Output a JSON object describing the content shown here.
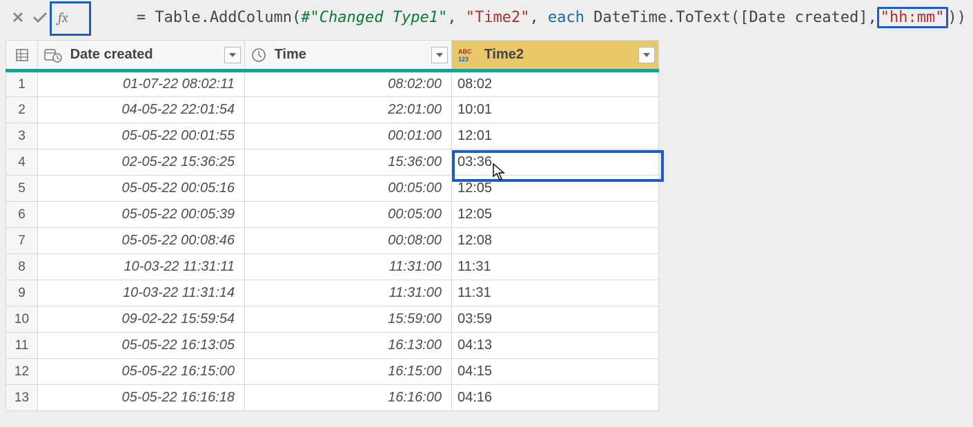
{
  "formula_bar": {
    "eq": "= ",
    "fn1": "Table.AddColumn",
    "open": "(",
    "ref": "#\"Changed Type1\"",
    "c1": ", ",
    "str1": "\"Time2\"",
    "c2": ", ",
    "kw": "each",
    "sp": " ",
    "fn2": "DateTime.ToText",
    "open2": "(",
    "col": "[Date created]",
    "c3": ",",
    "str2": "\"hh:mm\"",
    "close2": ")",
    "close": ")"
  },
  "fx_label": "fx",
  "columns": {
    "date": "Date created",
    "time": "Time",
    "time2": "Time2"
  },
  "rows": [
    {
      "n": "1",
      "date": "01-07-22 08:02:11",
      "time": "08:02:00",
      "time2": "08:02"
    },
    {
      "n": "2",
      "date": "04-05-22 22:01:54",
      "time": "22:01:00",
      "time2": "10:01"
    },
    {
      "n": "3",
      "date": "05-05-22 00:01:55",
      "time": "00:01:00",
      "time2": "12:01"
    },
    {
      "n": "4",
      "date": "02-05-22 15:36:25",
      "time": "15:36:00",
      "time2": "03:36"
    },
    {
      "n": "5",
      "date": "05-05-22 00:05:16",
      "time": "00:05:00",
      "time2": "12:05"
    },
    {
      "n": "6",
      "date": "05-05-22 00:05:39",
      "time": "00:05:00",
      "time2": "12:05"
    },
    {
      "n": "7",
      "date": "05-05-22 00:08:46",
      "time": "00:08:00",
      "time2": "12:08"
    },
    {
      "n": "8",
      "date": "10-03-22 11:31:11",
      "time": "11:31:00",
      "time2": "11:31"
    },
    {
      "n": "9",
      "date": "10-03-22 11:31:14",
      "time": "11:31:00",
      "time2": "11:31"
    },
    {
      "n": "10",
      "date": "09-02-22 15:59:54",
      "time": "15:59:00",
      "time2": "03:59"
    },
    {
      "n": "11",
      "date": "05-05-22 16:13:05",
      "time": "16:13:00",
      "time2": "04:13"
    },
    {
      "n": "12",
      "date": "05-05-22 16:15:00",
      "time": "16:15:00",
      "time2": "04:15"
    },
    {
      "n": "13",
      "date": "05-05-22 16:16:18",
      "time": "16:16:00",
      "time2": "04:16"
    }
  ],
  "highlighted_row_index": 3,
  "colors": {
    "accent": "#1C5CC3",
    "header_underline": "#1aa18f",
    "selected_header_bg": "#e9c86a"
  }
}
